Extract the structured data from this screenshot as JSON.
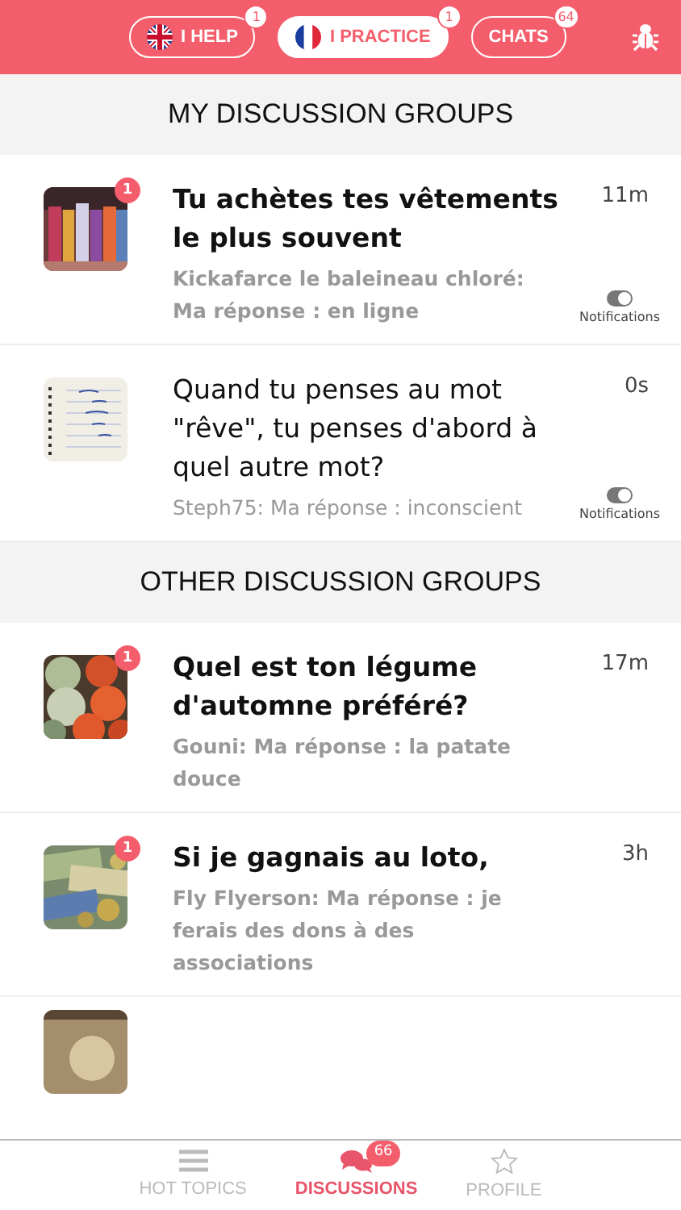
{
  "header": {
    "tabs": [
      {
        "label": "I HELP",
        "badge": "1",
        "selected": false
      },
      {
        "label": "I PRACTICE",
        "badge": "1",
        "selected": true
      },
      {
        "label": "CHATS",
        "badge": "64",
        "selected": false
      }
    ]
  },
  "sections": [
    {
      "title": "MY DISCUSSION GROUPS",
      "groups": [
        {
          "title": "Tu achètes tes vêtements le plus souvent",
          "last_message": "Kickafarce le baleineau chloré: Ma réponse : en ligne",
          "time": "11m",
          "badge": "1",
          "unread": true,
          "notifications": {
            "label": "Notifications",
            "on": true
          }
        },
        {
          "title": "Quand tu penses au mot \"rêve\", tu penses d'abord à quel autre mot?",
          "last_message": "Steph75: Ma réponse : inconscient",
          "time": "0s",
          "unread": false,
          "notifications": {
            "label": "Notifications",
            "on": true
          }
        }
      ]
    },
    {
      "title": "OTHER DISCUSSION GROUPS",
      "groups": [
        {
          "title": "Quel est ton légume d'automne préféré?",
          "last_message": "Gouni: Ma réponse : la patate douce",
          "time": "17m",
          "badge": "1",
          "unread": true
        },
        {
          "title": "Si je gagnais au loto,",
          "last_message": "Fly Flyerson: Ma réponse : je ferais des dons à des associations",
          "time": "3h",
          "badge": "1",
          "unread": true
        }
      ]
    }
  ],
  "tab_bar": [
    {
      "label": "HOT TOPICS",
      "selected": false
    },
    {
      "label": "DISCUSSIONS",
      "badge": "66",
      "selected": true
    },
    {
      "label": "PROFILE",
      "selected": false
    }
  ]
}
